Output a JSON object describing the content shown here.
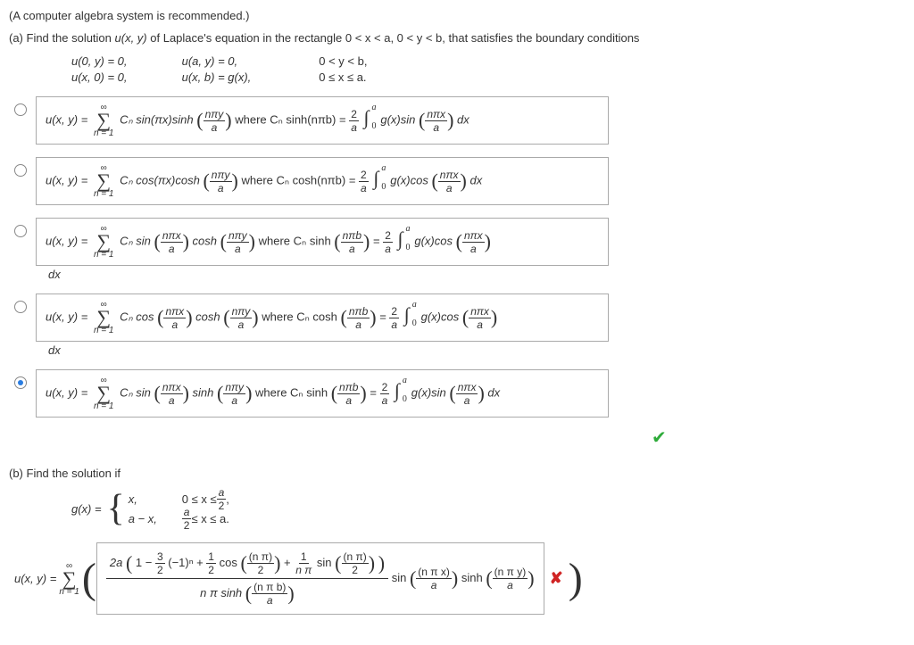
{
  "intro": "(A computer algebra system is recommended.)",
  "partA": {
    "prompt_pre": "(a) Find the solution  ",
    "uxy": "u(x, y)",
    "prompt_mid": "  of Laplace's equation in the rectangle  ",
    "rect": "0 < x < a,   0 < y < b,",
    "prompt_post": "  that satisfies the boundary conditions",
    "bc": {
      "r1c1": "u(0, y)  =  0,",
      "r1c2": "u(a, y)  =  0,",
      "r1c3": "0 < y < b,",
      "r2c1": "u(x, 0)  =  0,",
      "r2c2": "u(x, b)  =  g(x),",
      "r2c3": "0 ≤ x ≤ a."
    }
  },
  "sum": {
    "top": "∞",
    "bottom": "n = 1"
  },
  "integral": {
    "upper": "a",
    "lower": "0"
  },
  "two_over_a": {
    "num": "2",
    "den": "a"
  },
  "options": {
    "o1": {
      "uxy": "u(x, y)  = ",
      "prefix": "Cₙ sin(πx)sinh",
      "arg1_num": "nπy",
      "arg1_den": "a",
      "where": " where Cₙ sinh(nπb) = ",
      "gpart": "g(x)sin",
      "arg2_num": "nπx",
      "arg2_den": "a",
      "dx": " dx"
    },
    "o2": {
      "uxy": "u(x, y)  = ",
      "prefix": "Cₙ cos(πx)cosh",
      "arg1_num": "nπy",
      "arg1_den": "a",
      "where": " where Cₙ cosh(nπb) = ",
      "gpart": "g(x)cos",
      "arg2_num": "nπx",
      "arg2_den": "a",
      "dx": " dx"
    },
    "o3": {
      "uxy": "u(x, y)  = ",
      "prefix": "Cₙ sin",
      "arg0_num": "nπx",
      "arg0_den": "a",
      "mid": "cosh",
      "arg1_num": "nπy",
      "arg1_den": "a",
      "where": " where Cₙ sinh",
      "argw_num": "nπb",
      "argw_den": "a",
      "eq": " = ",
      "gpart": "g(x)cos",
      "arg2_num": "nπx",
      "arg2_den": "a",
      "dx": "dx"
    },
    "o4": {
      "uxy": "u(x, y)  = ",
      "prefix": "Cₙ cos",
      "arg0_num": "nπx",
      "arg0_den": "a",
      "mid": "cosh",
      "arg1_num": "nπy",
      "arg1_den": "a",
      "where": " where Cₙ cosh",
      "argw_num": "nπb",
      "argw_den": "a",
      "eq": " = ",
      "gpart": "g(x)cos",
      "arg2_num": "nπx",
      "arg2_den": "a",
      "dx": "dx"
    },
    "o5": {
      "uxy": "u(x, y)  = ",
      "prefix": "Cₙ sin",
      "arg0_num": "nπx",
      "arg0_den": "a",
      "mid": "sinh",
      "arg1_num": "nπy",
      "arg1_den": "a",
      "where": " where Cₙ sinh",
      "argw_num": "nπb",
      "argw_den": "a",
      "eq": " = ",
      "gpart": "g(x)sin",
      "arg2_num": "nπx",
      "arg2_den": "a",
      "dx": " dx"
    }
  },
  "partB": {
    "prompt": "(b) Find the solution if",
    "gx_label": "g(x)  = ",
    "piece1_left": "x,",
    "piece1_right_pre": "0 ≤ x ≤ ",
    "piece1_right_num": "a",
    "piece1_right_den": "2",
    "piece1_right_post": ",",
    "piece2_left": "a − x,",
    "piece2_right_num": "a",
    "piece2_right_den": "2",
    "piece2_right_post": " ≤ x ≤ a."
  },
  "final": {
    "uxy": "u(x, y)  = ",
    "big_open": "(",
    "numA_pre": "2a",
    "numA_open": "(",
    "numA_1": "1 − ",
    "numA_frac_num": "3",
    "numA_frac_den": "2",
    "numA_neg1n": "(−1)ⁿ + ",
    "numA_half_num": "1",
    "numA_half_den": "2",
    "numA_cos": "cos",
    "numA_cos_arg_num": "(n π)",
    "numA_cos_arg_den": "2",
    "numA_plus": " + ",
    "numA_1_over_npi_num": "1",
    "numA_1_over_npi_den": "n π",
    "numA_sin": "sin",
    "numA_sin_arg_num": "(n π)",
    "numA_sin_arg_den": "2",
    "numA_close": ")",
    "den_pre": "n π  sinh",
    "den_arg_num": "(n π b)",
    "den_arg_den": "a",
    "tail_sin": "sin",
    "tail_s1_num": "(n π x)",
    "tail_s1_den": "a",
    "tail_sinh": "sinh",
    "tail_s2_num": "(n π y)",
    "tail_s2_den": "a",
    "big_close": ")"
  }
}
